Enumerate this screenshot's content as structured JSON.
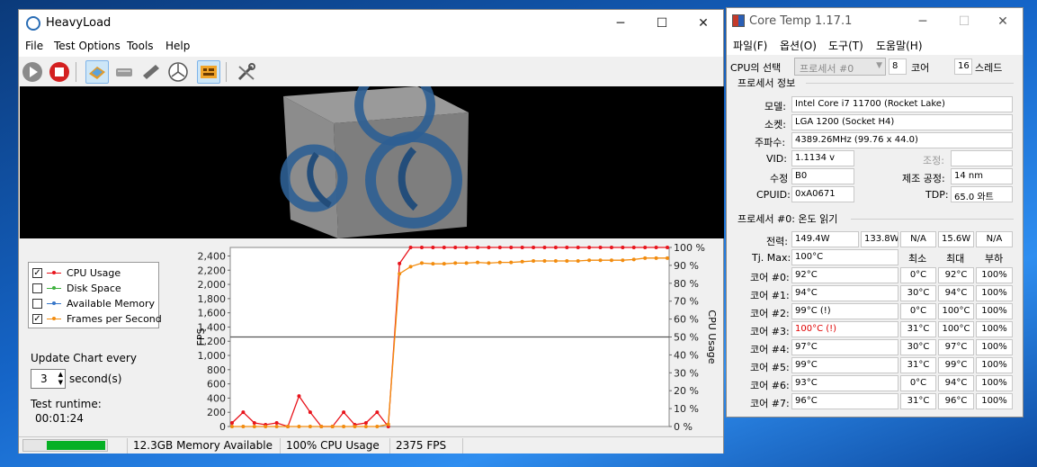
{
  "heavyload": {
    "title": "HeavyLoad",
    "menu": [
      "File",
      "Test Options",
      "Tools",
      "Help"
    ],
    "toolbar": [
      "play-icon",
      "stop-icon",
      "cpu-stress-icon",
      "disk-stress-icon",
      "memory-stress-icon",
      "gpu-stress-icon",
      "test-selection-icon",
      "settings-wrench-icon"
    ],
    "legend": [
      {
        "label": "CPU Usage",
        "checked": true,
        "color": "#e8141c"
      },
      {
        "label": "Disk Space",
        "checked": false,
        "color": "#3db03d"
      },
      {
        "label": "Available Memory",
        "checked": false,
        "color": "#3776c9"
      },
      {
        "label": "Frames per Second",
        "checked": true,
        "color": "#f28c0f"
      }
    ],
    "update_label": "Update Chart every",
    "interval": "3",
    "interval_unit": "second(s)",
    "runtime_label": "Test runtime:",
    "runtime": "00:01:24",
    "status": {
      "progress": 1.0,
      "memory": "12.3GB Memory Available",
      "cpu": "100% CPU Usage",
      "fps": "2375 FPS"
    }
  },
  "chart_data": {
    "type": "line",
    "ylabel": "FPS",
    "y2label": "CPU Usage",
    "yticks": [
      "0",
      "200",
      "400",
      "600",
      "800",
      "1,000",
      "1,200",
      "1,400",
      "1,600",
      "1,800",
      "2,000",
      "2,200",
      "2,400"
    ],
    "y2ticks": [
      "0 %",
      "10 %",
      "20 %",
      "30 %",
      "40 %",
      "50 %",
      "60 %",
      "70 %",
      "80 %",
      "90 %",
      "100 %"
    ],
    "ylim": [
      0,
      2520
    ],
    "y2lim": [
      0,
      100
    ],
    "series": [
      {
        "name": "CPU Usage",
        "color": "#e8141c",
        "axis": "right",
        "values": [
          2,
          8,
          2,
          1,
          2,
          0,
          17,
          8,
          0,
          0,
          8,
          1,
          2,
          8,
          0,
          91,
          100,
          100,
          100,
          100,
          100,
          100,
          100,
          100,
          100,
          100,
          100,
          100,
          100,
          100,
          100,
          100,
          100,
          100,
          100,
          100,
          100,
          100,
          100,
          100
        ]
      },
      {
        "name": "Frames per Second",
        "color": "#f28c0f",
        "axis": "left",
        "values": [
          0,
          0,
          0,
          0,
          0,
          0,
          0,
          0,
          0,
          0,
          0,
          0,
          0,
          0,
          30,
          2150,
          2250,
          2300,
          2290,
          2290,
          2300,
          2300,
          2310,
          2300,
          2310,
          2310,
          2320,
          2330,
          2330,
          2330,
          2330,
          2330,
          2340,
          2340,
          2340,
          2340,
          2350,
          2370,
          2370,
          2370
        ]
      }
    ]
  },
  "coretemp": {
    "title": "Core Temp 1.17.1",
    "menu": [
      "파일(F)",
      "옵션(O)",
      "도구(T)",
      "도움말(H)"
    ],
    "cpu_select_label": "CPU의 선택",
    "cpu_select_value": "프로세서 #0",
    "cores_count": "8",
    "cores_label": "코어",
    "threads_count": "16",
    "threads_label": "스레드",
    "proc_info_label": "프로세서 정보",
    "model_label": "모델:",
    "model": "Intel Core i7 11700 (Rocket Lake)",
    "socket_label": "소켓:",
    "socket": "LGA 1200 (Socket H4)",
    "freq_label": "주파수:",
    "freq": "4389.26MHz (99.76 x 44.0)",
    "vid_label": "VID:",
    "vid": "1.1134 v",
    "adjust_label": "조정:",
    "adjust": "",
    "rev_label": "수정",
    "rev": "B0",
    "lith_label": "제조 공정:",
    "lith": "14 nm",
    "cpuid_label": "CPUID:",
    "cpuid": "0xA0671",
    "tdp_label": "TDP:",
    "tdp": "65.0 와트",
    "temp_label": "프로세서 #0: 온도 읽기",
    "power_label": "전력:",
    "power": [
      "149.4W",
      "133.8W",
      "N/A",
      "15.6W",
      "N/A"
    ],
    "tjmax_label": "Tj. Max:",
    "tjmax": "100°C",
    "col_min": "최소",
    "col_max": "최대",
    "col_load": "부하",
    "cores": [
      {
        "label": "코어 #0:",
        "temp": "92°C",
        "min": "0°C",
        "max": "92°C",
        "load": "100%",
        "hot": false
      },
      {
        "label": "코어 #1:",
        "temp": "94°C",
        "min": "30°C",
        "max": "94°C",
        "load": "100%",
        "hot": false
      },
      {
        "label": "코어 #2:",
        "temp": "99°C (!)",
        "min": "0°C",
        "max": "100°C",
        "load": "100%",
        "hot": false
      },
      {
        "label": "코어 #3:",
        "temp": "100°C (!)",
        "min": "31°C",
        "max": "100°C",
        "load": "100%",
        "hot": true
      },
      {
        "label": "코어 #4:",
        "temp": "97°C",
        "min": "30°C",
        "max": "97°C",
        "load": "100%",
        "hot": false
      },
      {
        "label": "코어 #5:",
        "temp": "99°C",
        "min": "31°C",
        "max": "99°C",
        "load": "100%",
        "hot": false
      },
      {
        "label": "코어 #6:",
        "temp": "93°C",
        "min": "0°C",
        "max": "94°C",
        "load": "100%",
        "hot": false
      },
      {
        "label": "코어 #7:",
        "temp": "96°C",
        "min": "31°C",
        "max": "96°C",
        "load": "100%",
        "hot": false
      }
    ]
  }
}
